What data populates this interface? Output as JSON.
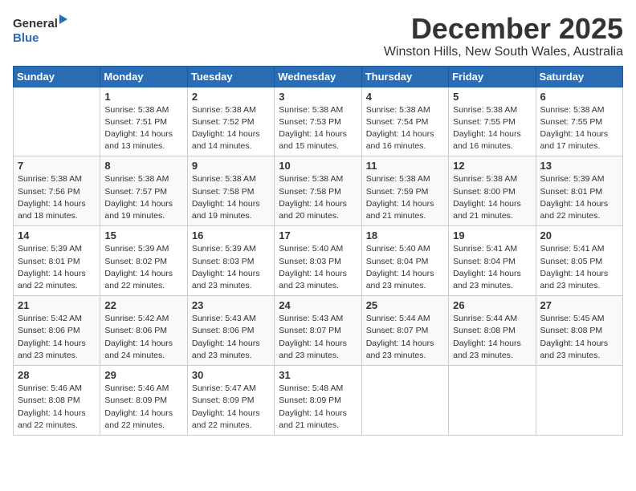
{
  "logo": {
    "general": "General",
    "blue": "Blue"
  },
  "title": "December 2025",
  "subtitle": "Winston Hills, New South Wales, Australia",
  "days_header": [
    "Sunday",
    "Monday",
    "Tuesday",
    "Wednesday",
    "Thursday",
    "Friday",
    "Saturday"
  ],
  "weeks": [
    [
      {
        "day": "",
        "info": ""
      },
      {
        "day": "1",
        "info": "Sunrise: 5:38 AM\nSunset: 7:51 PM\nDaylight: 14 hours\nand 13 minutes."
      },
      {
        "day": "2",
        "info": "Sunrise: 5:38 AM\nSunset: 7:52 PM\nDaylight: 14 hours\nand 14 minutes."
      },
      {
        "day": "3",
        "info": "Sunrise: 5:38 AM\nSunset: 7:53 PM\nDaylight: 14 hours\nand 15 minutes."
      },
      {
        "day": "4",
        "info": "Sunrise: 5:38 AM\nSunset: 7:54 PM\nDaylight: 14 hours\nand 16 minutes."
      },
      {
        "day": "5",
        "info": "Sunrise: 5:38 AM\nSunset: 7:55 PM\nDaylight: 14 hours\nand 16 minutes."
      },
      {
        "day": "6",
        "info": "Sunrise: 5:38 AM\nSunset: 7:55 PM\nDaylight: 14 hours\nand 17 minutes."
      }
    ],
    [
      {
        "day": "7",
        "info": "Sunrise: 5:38 AM\nSunset: 7:56 PM\nDaylight: 14 hours\nand 18 minutes."
      },
      {
        "day": "8",
        "info": "Sunrise: 5:38 AM\nSunset: 7:57 PM\nDaylight: 14 hours\nand 19 minutes."
      },
      {
        "day": "9",
        "info": "Sunrise: 5:38 AM\nSunset: 7:58 PM\nDaylight: 14 hours\nand 19 minutes."
      },
      {
        "day": "10",
        "info": "Sunrise: 5:38 AM\nSunset: 7:58 PM\nDaylight: 14 hours\nand 20 minutes."
      },
      {
        "day": "11",
        "info": "Sunrise: 5:38 AM\nSunset: 7:59 PM\nDaylight: 14 hours\nand 21 minutes."
      },
      {
        "day": "12",
        "info": "Sunrise: 5:38 AM\nSunset: 8:00 PM\nDaylight: 14 hours\nand 21 minutes."
      },
      {
        "day": "13",
        "info": "Sunrise: 5:39 AM\nSunset: 8:01 PM\nDaylight: 14 hours\nand 22 minutes."
      }
    ],
    [
      {
        "day": "14",
        "info": "Sunrise: 5:39 AM\nSunset: 8:01 PM\nDaylight: 14 hours\nand 22 minutes."
      },
      {
        "day": "15",
        "info": "Sunrise: 5:39 AM\nSunset: 8:02 PM\nDaylight: 14 hours\nand 22 minutes."
      },
      {
        "day": "16",
        "info": "Sunrise: 5:39 AM\nSunset: 8:03 PM\nDaylight: 14 hours\nand 23 minutes."
      },
      {
        "day": "17",
        "info": "Sunrise: 5:40 AM\nSunset: 8:03 PM\nDaylight: 14 hours\nand 23 minutes."
      },
      {
        "day": "18",
        "info": "Sunrise: 5:40 AM\nSunset: 8:04 PM\nDaylight: 14 hours\nand 23 minutes."
      },
      {
        "day": "19",
        "info": "Sunrise: 5:41 AM\nSunset: 8:04 PM\nDaylight: 14 hours\nand 23 minutes."
      },
      {
        "day": "20",
        "info": "Sunrise: 5:41 AM\nSunset: 8:05 PM\nDaylight: 14 hours\nand 23 minutes."
      }
    ],
    [
      {
        "day": "21",
        "info": "Sunrise: 5:42 AM\nSunset: 8:06 PM\nDaylight: 14 hours\nand 23 minutes."
      },
      {
        "day": "22",
        "info": "Sunrise: 5:42 AM\nSunset: 8:06 PM\nDaylight: 14 hours\nand 24 minutes."
      },
      {
        "day": "23",
        "info": "Sunrise: 5:43 AM\nSunset: 8:06 PM\nDaylight: 14 hours\nand 23 minutes."
      },
      {
        "day": "24",
        "info": "Sunrise: 5:43 AM\nSunset: 8:07 PM\nDaylight: 14 hours\nand 23 minutes."
      },
      {
        "day": "25",
        "info": "Sunrise: 5:44 AM\nSunset: 8:07 PM\nDaylight: 14 hours\nand 23 minutes."
      },
      {
        "day": "26",
        "info": "Sunrise: 5:44 AM\nSunset: 8:08 PM\nDaylight: 14 hours\nand 23 minutes."
      },
      {
        "day": "27",
        "info": "Sunrise: 5:45 AM\nSunset: 8:08 PM\nDaylight: 14 hours\nand 23 minutes."
      }
    ],
    [
      {
        "day": "28",
        "info": "Sunrise: 5:46 AM\nSunset: 8:08 PM\nDaylight: 14 hours\nand 22 minutes."
      },
      {
        "day": "29",
        "info": "Sunrise: 5:46 AM\nSunset: 8:09 PM\nDaylight: 14 hours\nand 22 minutes."
      },
      {
        "day": "30",
        "info": "Sunrise: 5:47 AM\nSunset: 8:09 PM\nDaylight: 14 hours\nand 22 minutes."
      },
      {
        "day": "31",
        "info": "Sunrise: 5:48 AM\nSunset: 8:09 PM\nDaylight: 14 hours\nand 21 minutes."
      },
      {
        "day": "",
        "info": ""
      },
      {
        "day": "",
        "info": ""
      },
      {
        "day": "",
        "info": ""
      }
    ]
  ]
}
